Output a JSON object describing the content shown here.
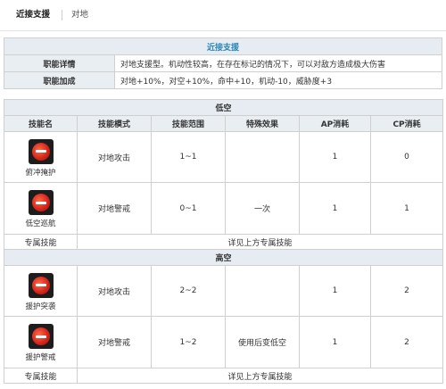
{
  "tabs": {
    "active": "近接支援",
    "inactive": "对地"
  },
  "info": {
    "header": "近接支援",
    "rows": [
      {
        "label": "职能详情",
        "value": "对地支援型。机动性较高，在存在标记的情况下，可以对敌方造成极大伤害"
      },
      {
        "label": "职能加成",
        "value": "对地+10%，对空+10%，命中+10，机动-10，威胁度+3"
      }
    ]
  },
  "skills": {
    "columns": [
      "技能名",
      "技能模式",
      "技能范围",
      "特殊效果",
      "AP消耗",
      "CP消耗"
    ],
    "low": {
      "title": "低空",
      "rows": [
        {
          "name": "俯冲掩护",
          "icon": "red-disc-skill-icon",
          "mode": "对地攻击",
          "range": "1~1",
          "effect": "",
          "ap": "1",
          "cp": "0"
        },
        {
          "name": "低空巡航",
          "icon": "red-disc-skill-icon",
          "mode": "对地警戒",
          "range": "0~1",
          "effect": "一次",
          "ap": "1",
          "cp": "1"
        }
      ],
      "exclusive": {
        "label": "专属技能",
        "value": "详见上方专属技能"
      }
    },
    "high": {
      "title": "高空",
      "rows": [
        {
          "name": "援护突袭",
          "icon": "red-disc-skill-icon",
          "mode": "对地攻击",
          "range": "2~2",
          "effect": "",
          "ap": "1",
          "cp": "2"
        },
        {
          "name": "援护警戒",
          "icon": "red-disc-skill-icon",
          "mode": "对地警戒",
          "range": "1~2",
          "effect": "使用后变低空",
          "ap": "1",
          "cp": "2"
        }
      ],
      "exclusive": {
        "label": "专属技能",
        "value": "详见上方专属技能"
      }
    }
  },
  "colors": {
    "header_bg": "#e6ecf1",
    "header_text": "#2a85b8",
    "border": "#cfcfcf",
    "icon_red": "#d8271c"
  }
}
